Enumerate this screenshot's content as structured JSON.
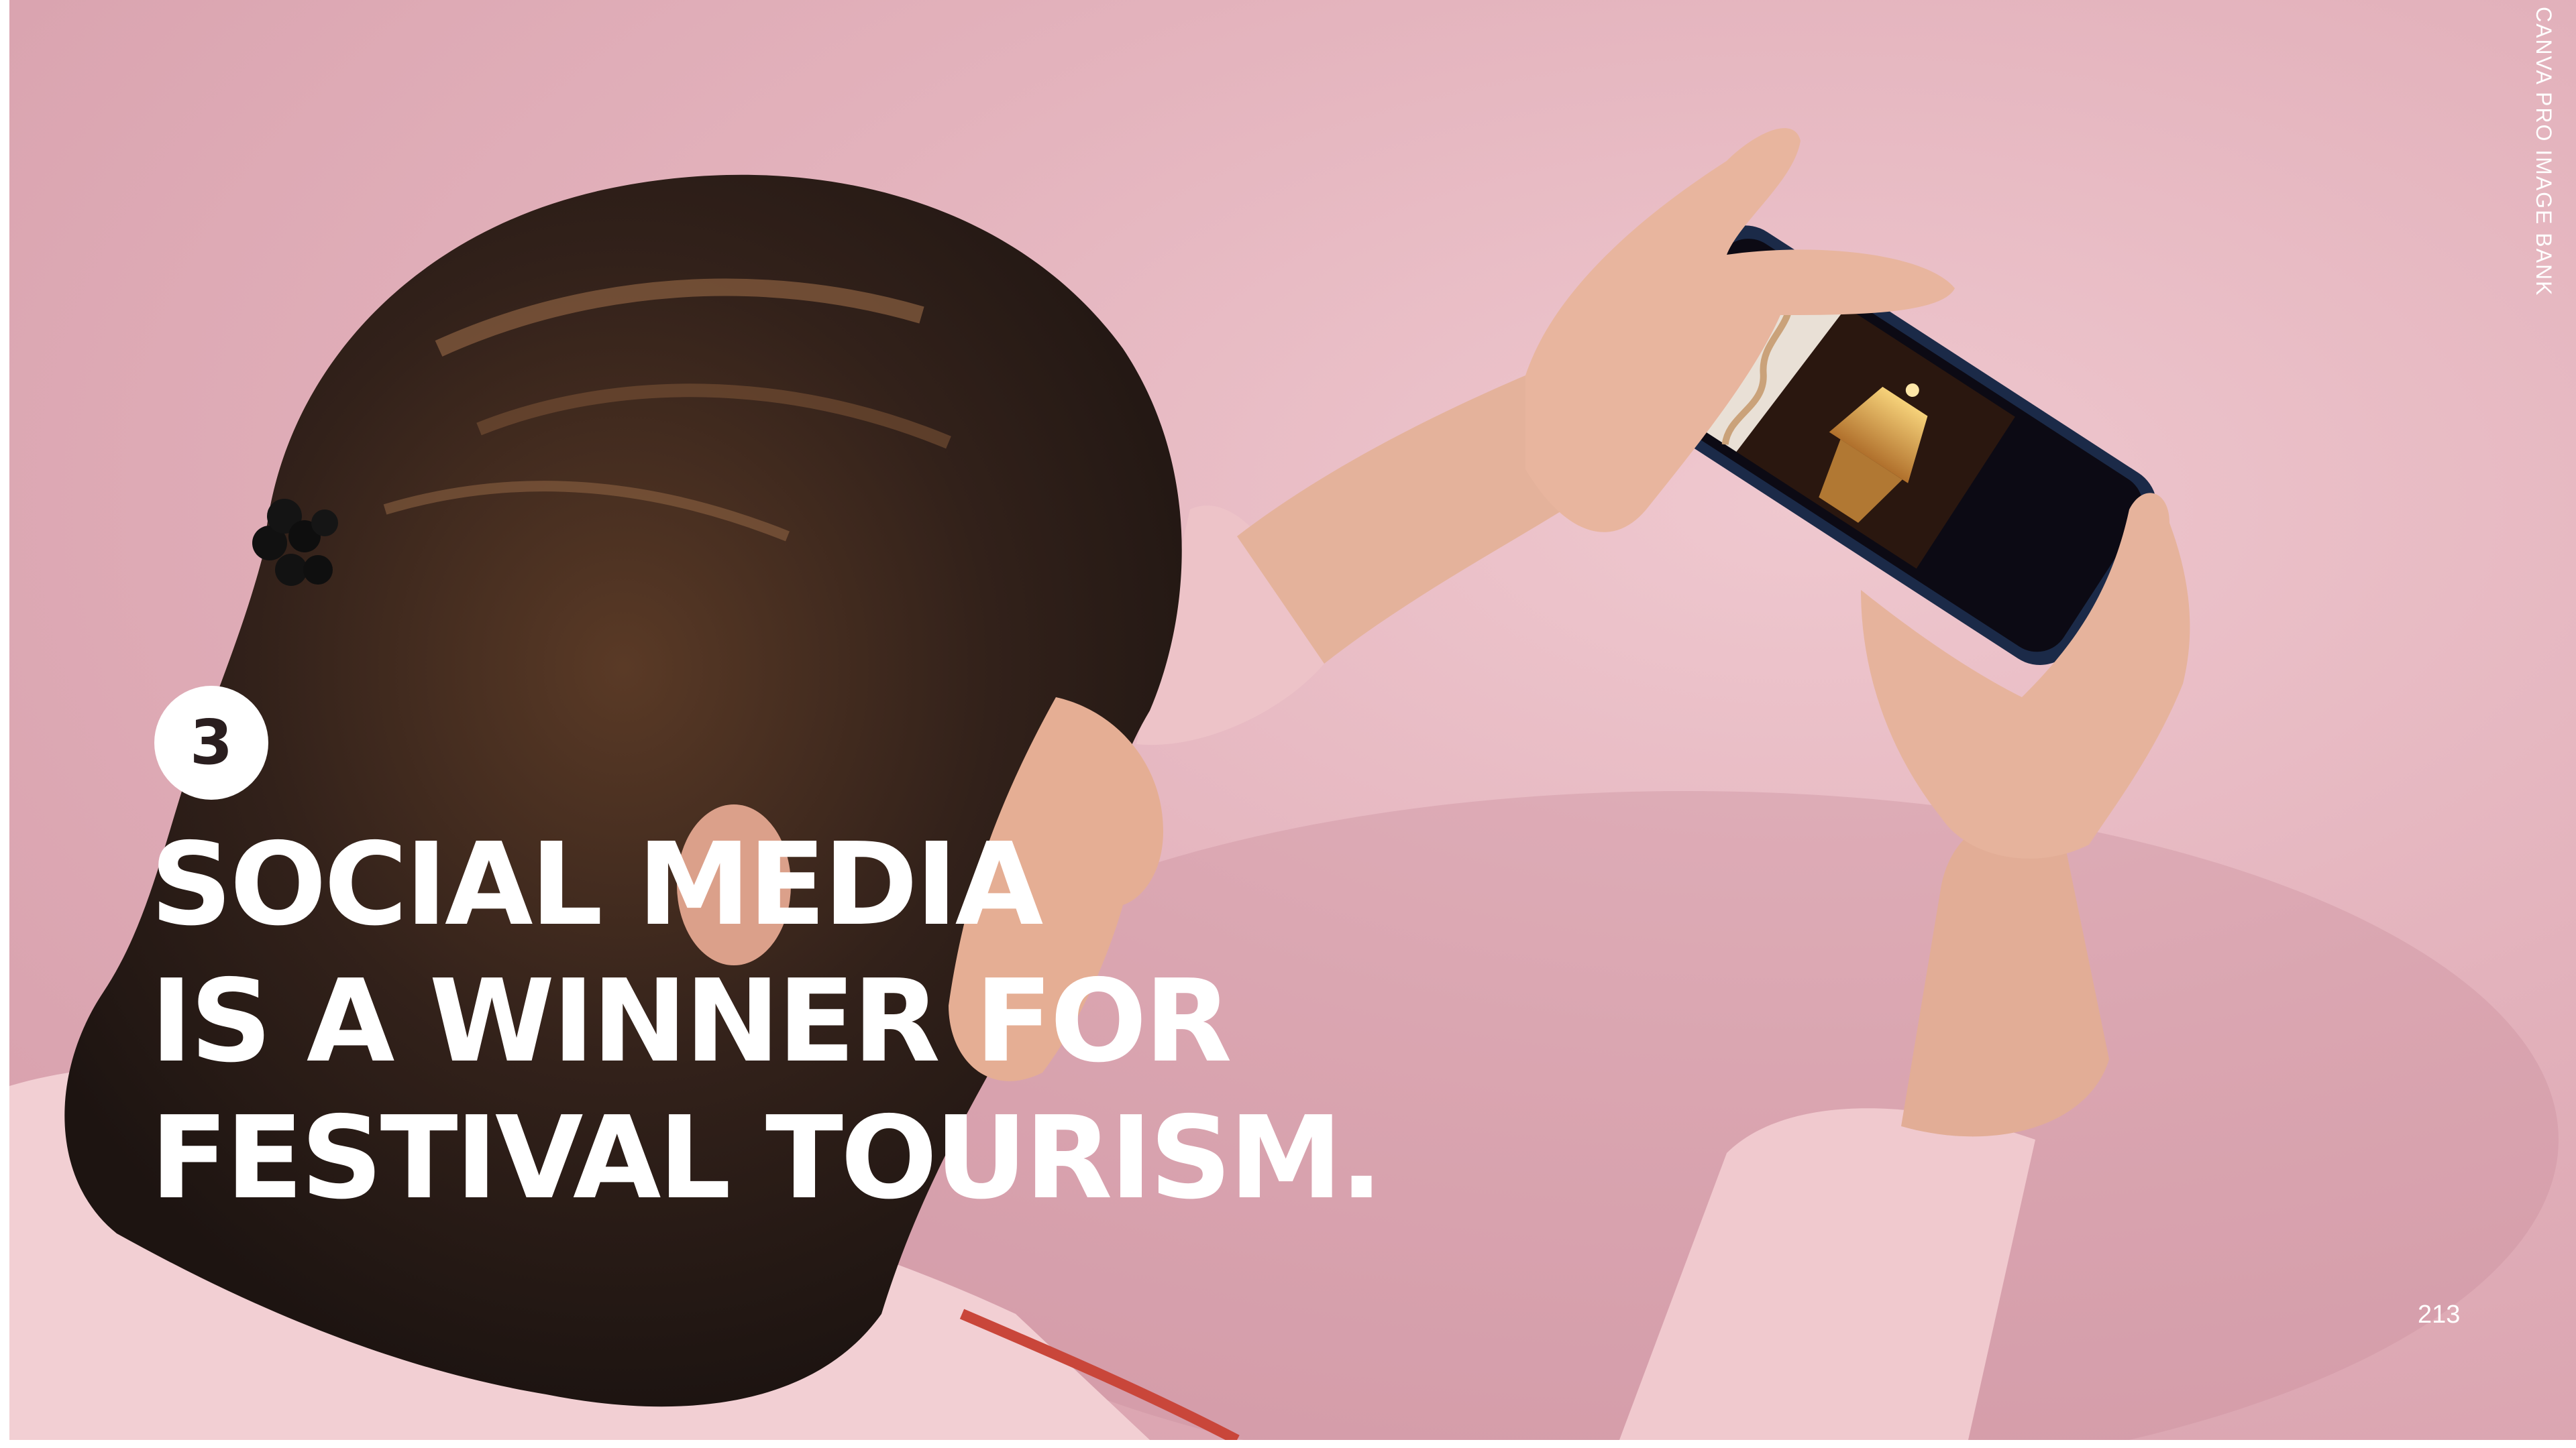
{
  "badge": {
    "number": "3"
  },
  "headline": {
    "lines": [
      "SOCIAL MEDIA",
      "IS A WINNER FOR",
      "FESTIVAL TOURISM."
    ]
  },
  "credit": "CANVA PRO IMAGE BANK",
  "page_number": "213",
  "colors": {
    "background": "#e3b2bc",
    "text": "#ffffff",
    "hair": "#2b1d17",
    "sweater": "#f0c8cd",
    "skin": "#e7b49a"
  },
  "photo": {
    "subject": "woman-holding-smartphone-photographing-lantern"
  }
}
